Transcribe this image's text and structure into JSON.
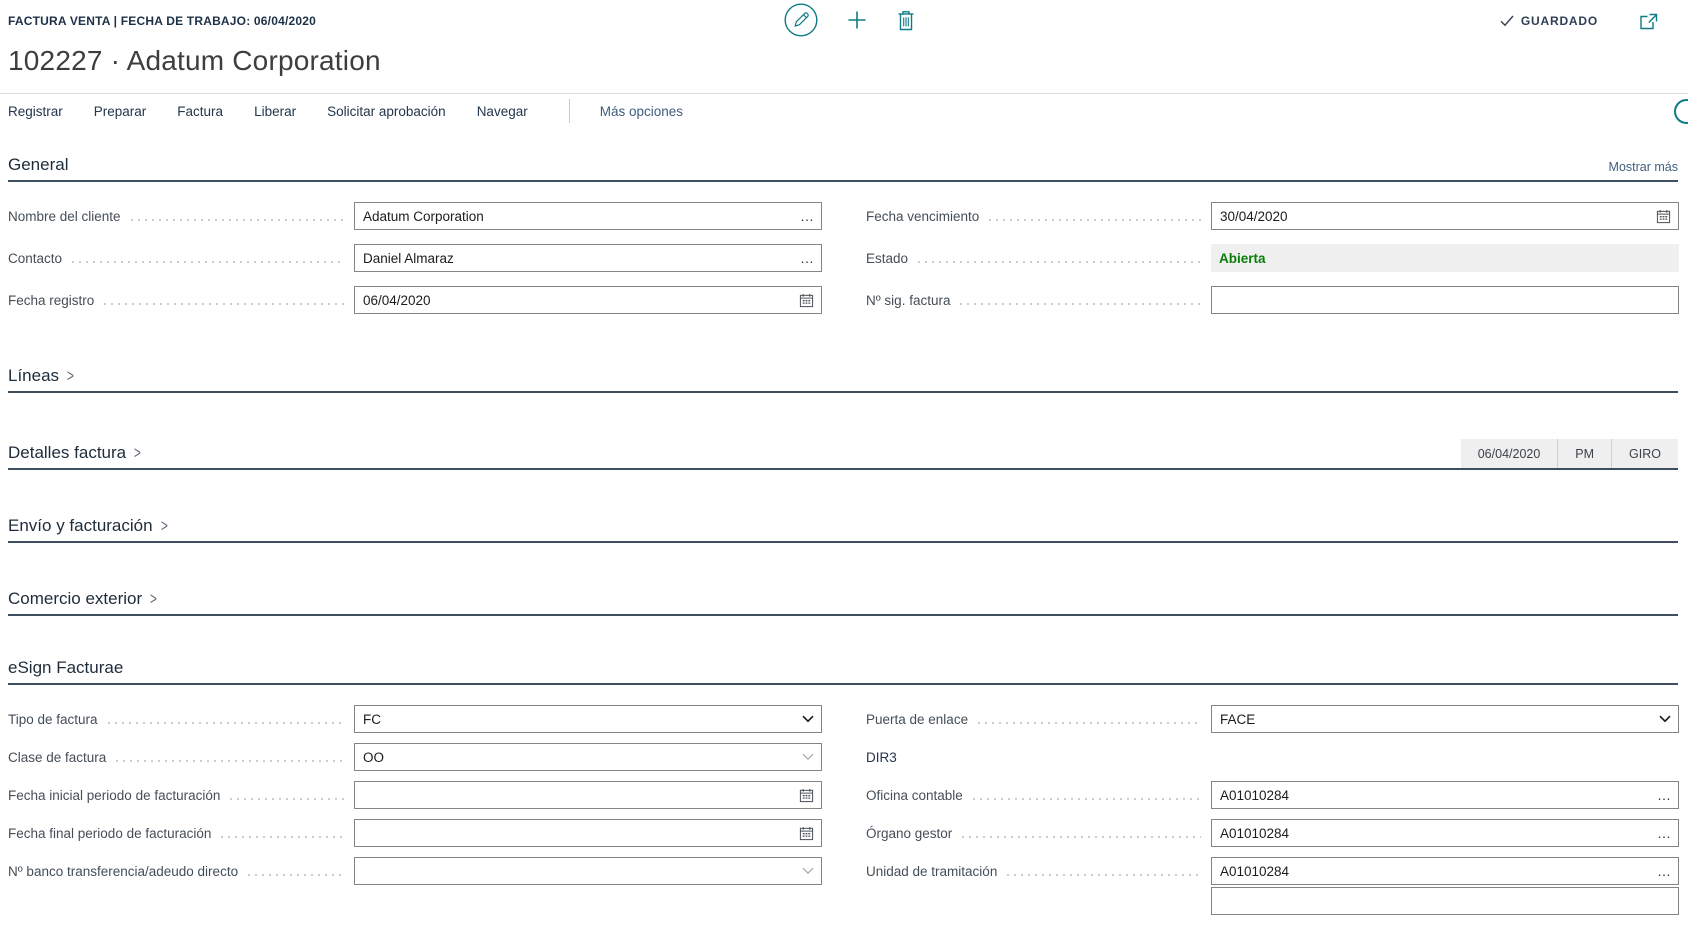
{
  "header": {
    "caption": "FACTURA VENTA | FECHA DE TRABAJO: 06/04/2020",
    "title": "102227 · Adatum Corporation",
    "saved_label": "GUARDADO"
  },
  "ribbon": {
    "items": [
      "Registrar",
      "Preparar",
      "Factura",
      "Liberar",
      "Solicitar aprobación",
      "Navegar"
    ],
    "more_label": "Más opciones"
  },
  "icons": {
    "assist": "…",
    "section_chevron": ">"
  },
  "colors": {
    "accent_teal": "#0e7b85",
    "status_open_green": "#0a7d0a"
  },
  "general": {
    "title": "General",
    "show_more": "Mostrar más",
    "left": [
      {
        "label": "Nombre del cliente",
        "value": "Adatum Corporation"
      },
      {
        "label": "Contacto",
        "value": "Daniel Almaraz"
      },
      {
        "label": "Fecha registro",
        "value": "06/04/2020"
      }
    ],
    "right": [
      {
        "label": "Fecha vencimiento",
        "value": "30/04/2020"
      },
      {
        "label": "Estado",
        "value": "Abierta"
      },
      {
        "label": "Nº sig. factura",
        "value": ""
      }
    ]
  },
  "collapsed": [
    {
      "title": "Líneas"
    },
    {
      "title": "Detalles factura",
      "badges": [
        "06/04/2020",
        "PM",
        "GIRO"
      ]
    },
    {
      "title": "Envío y facturación"
    },
    {
      "title": "Comercio exterior"
    }
  ],
  "esign": {
    "title": "eSign Facturae",
    "left": [
      {
        "label": "Tipo de factura",
        "value": "FC"
      },
      {
        "label": "Clase de factura",
        "value": "OO"
      },
      {
        "label": "Fecha inicial periodo de facturación",
        "value": ""
      },
      {
        "label": "Fecha final periodo de facturación",
        "value": ""
      },
      {
        "label": "Nº banco transferencia/adeudo directo",
        "value": ""
      }
    ],
    "right": {
      "puerta": {
        "label": "Puerta de enlace",
        "value": "FACE"
      },
      "dir3_label": "DIR3",
      "rows": [
        {
          "label": "Oficina contable",
          "value": "A01010284"
        },
        {
          "label": "Órgano gestor",
          "value": "A01010284"
        },
        {
          "label": "Unidad de tramitación",
          "value": "A01010284"
        }
      ]
    }
  }
}
